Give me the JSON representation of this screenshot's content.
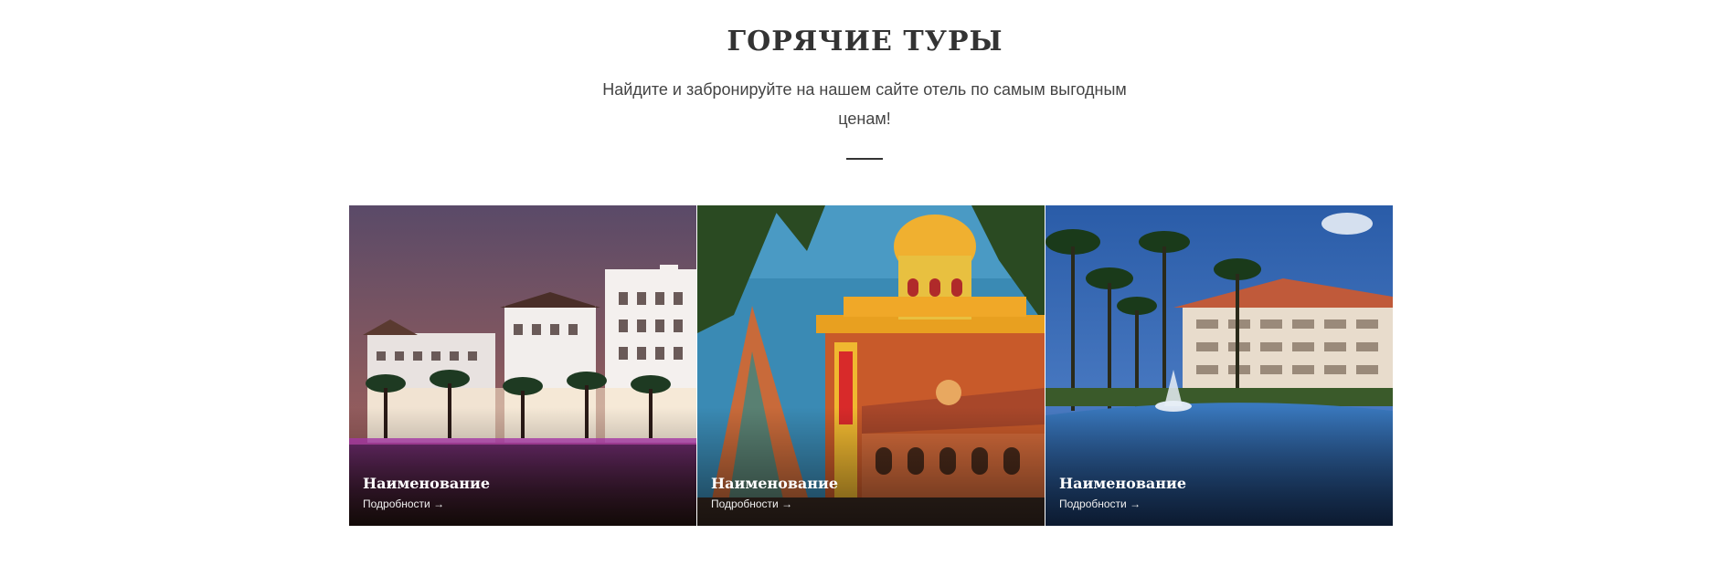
{
  "section": {
    "title": "ГОРЯЧИЕ ТУРЫ",
    "subtitle": "Найдите и забронируйте на нашем сайте отель по самым выгодным ценам!"
  },
  "cards": [
    {
      "name": "Наименование",
      "link": "Подробности →",
      "image": "night-hotel-photo"
    },
    {
      "name": "Наименование",
      "link": "Подробности →",
      "image": "temple-photo"
    },
    {
      "name": "Наименование",
      "link": "Подробности →",
      "image": "resort-pool-photo"
    }
  ]
}
